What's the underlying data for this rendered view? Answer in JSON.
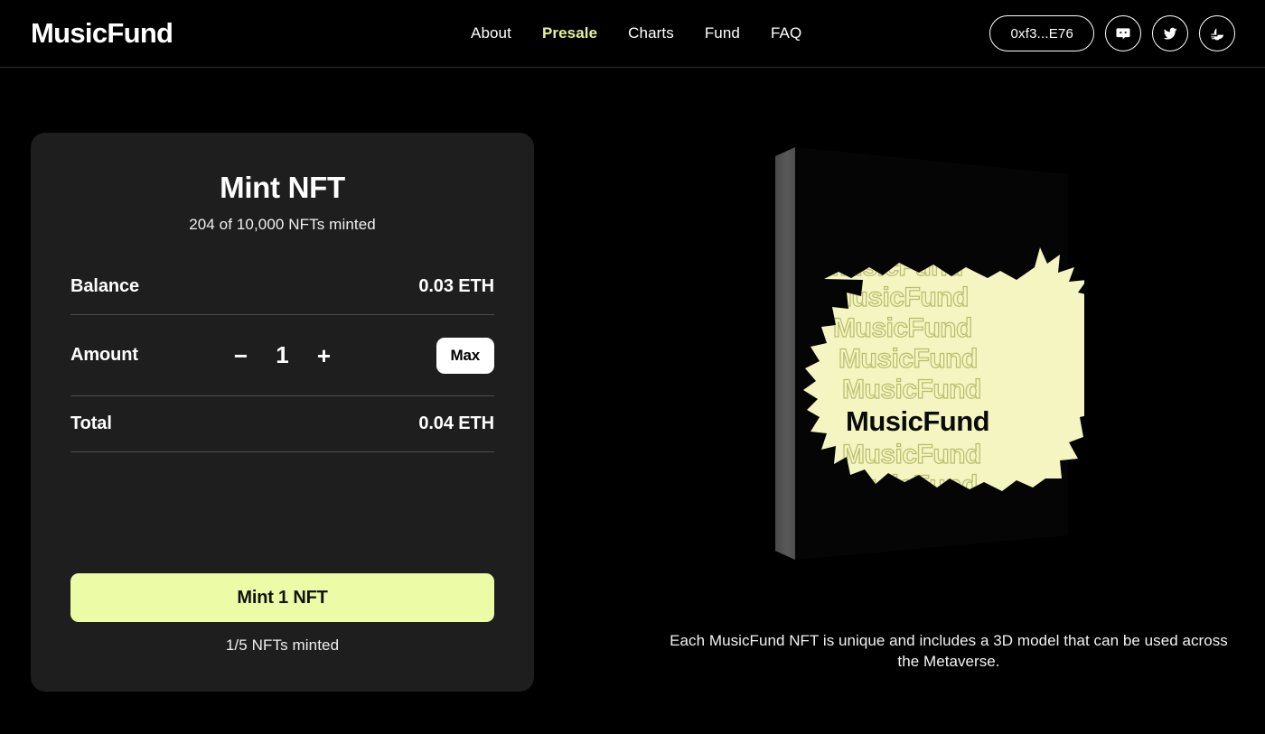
{
  "brand": {
    "logo_text": "MusicFund"
  },
  "header": {
    "nav": [
      {
        "label": "About",
        "active": false
      },
      {
        "label": "Presale",
        "active": true
      },
      {
        "label": "Charts",
        "active": false
      },
      {
        "label": "Fund",
        "active": false
      },
      {
        "label": "FAQ",
        "active": false
      }
    ],
    "wallet_label": "0xf3...E76",
    "social": [
      {
        "name": "discord-icon",
        "label": "Discord"
      },
      {
        "name": "twitter-icon",
        "label": "Twitter"
      },
      {
        "name": "opensea-icon",
        "label": "OpenSea"
      }
    ]
  },
  "mint_card": {
    "title": "Mint NFT",
    "subtitle": "204 of 10,000 NFTs minted",
    "minted_count": 204,
    "supply_total": "10,000",
    "rows": {
      "balance_label": "Balance",
      "balance_value": "0.03 ETH",
      "amount_label": "Amount",
      "amount_value": "1",
      "decrement_label": "−",
      "increment_label": "+",
      "max_label": "Max",
      "total_label": "Total",
      "total_value": "0.04 ETH"
    },
    "mint_button_label": "Mint 1 NFT",
    "status_text": "1/5 NFTs minted"
  },
  "preview": {
    "artwork_text": "MusicFund",
    "caption": "Each MusicFund NFT is unique and includes a 3D model that can be used across the Metaverse."
  },
  "colors": {
    "page_background": "#000000",
    "card_background": "#1e1e1e",
    "accent": "#ecfba6",
    "nav_active": "#e3f39b",
    "artwork_paint": "#f4f5c0",
    "artwork_edge": "#545454",
    "divider": "#4d4d4d",
    "text_primary": "#ffffff"
  }
}
